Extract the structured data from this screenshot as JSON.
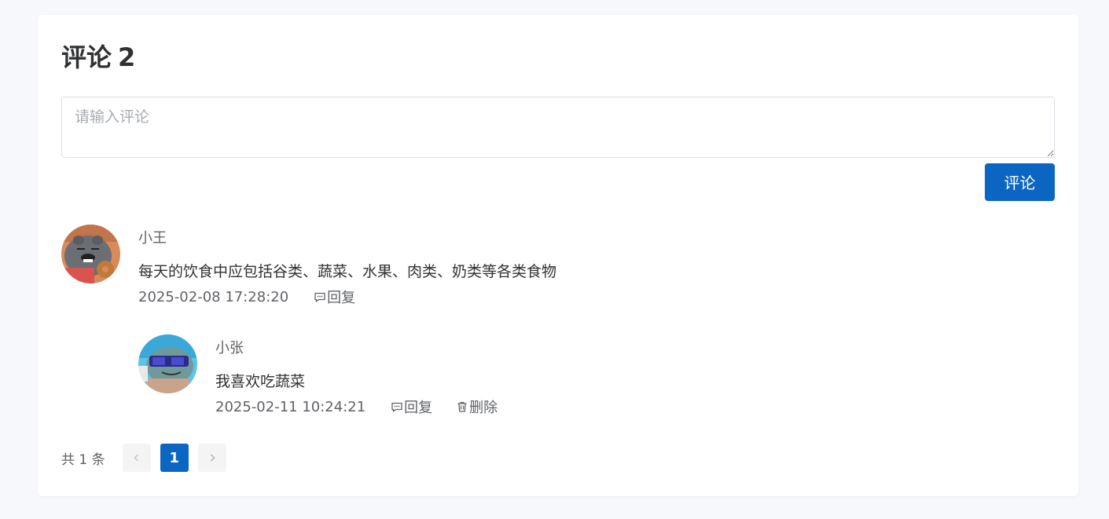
{
  "header": {
    "title": "评论",
    "count": "2"
  },
  "input": {
    "placeholder": "请输入评论",
    "value": ""
  },
  "submit_label": "评论",
  "comments": [
    {
      "user": "小王",
      "text": "每天的饮食中应包括谷类、蔬菜、水果、肉类、奶类等各类食物",
      "time": "2025-02-08 17:28:20",
      "actions": {
        "reply": "回复"
      },
      "replies": [
        {
          "user": "小张",
          "text": "我喜欢吃蔬菜",
          "time": "2025-02-11 10:24:21",
          "actions": {
            "reply": "回复",
            "delete": "删除"
          }
        }
      ]
    }
  ],
  "pagination": {
    "total_text": "共 1 条",
    "current_page": "1"
  },
  "colors": {
    "primary": "#0a66c2",
    "background": "#f7f8fc",
    "text": "#303133",
    "secondary_text": "#606266"
  },
  "icons": [
    "comment-icon",
    "trash-icon",
    "chevron-left-icon",
    "chevron-right-icon"
  ]
}
